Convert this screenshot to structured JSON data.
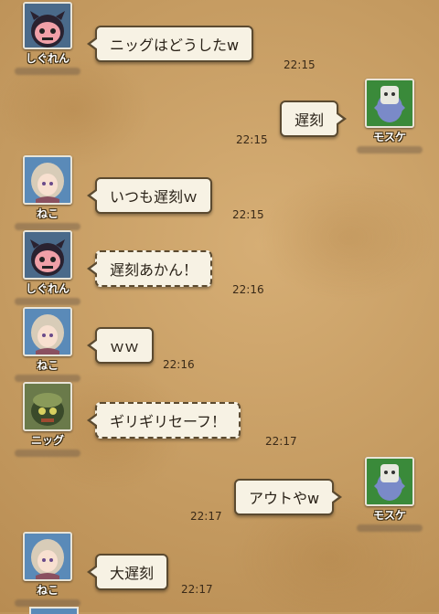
{
  "messages": [
    {
      "speaker": "しぐれん",
      "text": "ニッグはどうしたw",
      "time": "22:15",
      "side": "left",
      "avatar": "shiguren"
    },
    {
      "speaker": "モスケ",
      "text": "遅刻",
      "time": "22:15",
      "side": "right",
      "avatar": "mosuke"
    },
    {
      "speaker": "ねこ",
      "text": "いつも遅刻ｗ",
      "time": "22:15",
      "side": "left",
      "avatar": "neko"
    },
    {
      "speaker": "しぐれん",
      "text": "遅刻あかん！",
      "time": "22:16",
      "side": "left",
      "avatar": "shiguren"
    },
    {
      "speaker": "ねこ",
      "text": "ｗｗ",
      "time": "22:16",
      "side": "left",
      "avatar": "neko"
    },
    {
      "speaker": "ニッグ",
      "text": "ギリギリセーフ！",
      "time": "22:17",
      "side": "left",
      "avatar": "niggu"
    },
    {
      "speaker": "モスケ",
      "text": "アウトやw",
      "time": "22:17",
      "side": "right",
      "avatar": "mosuke"
    },
    {
      "speaker": "ねこ",
      "text": "大遅刻",
      "time": "22:17",
      "side": "left",
      "avatar": "neko"
    }
  ],
  "colors": {
    "background": "#c9a068",
    "bubble": "#f7f2e4",
    "bubble_border": "#5b4a30"
  }
}
